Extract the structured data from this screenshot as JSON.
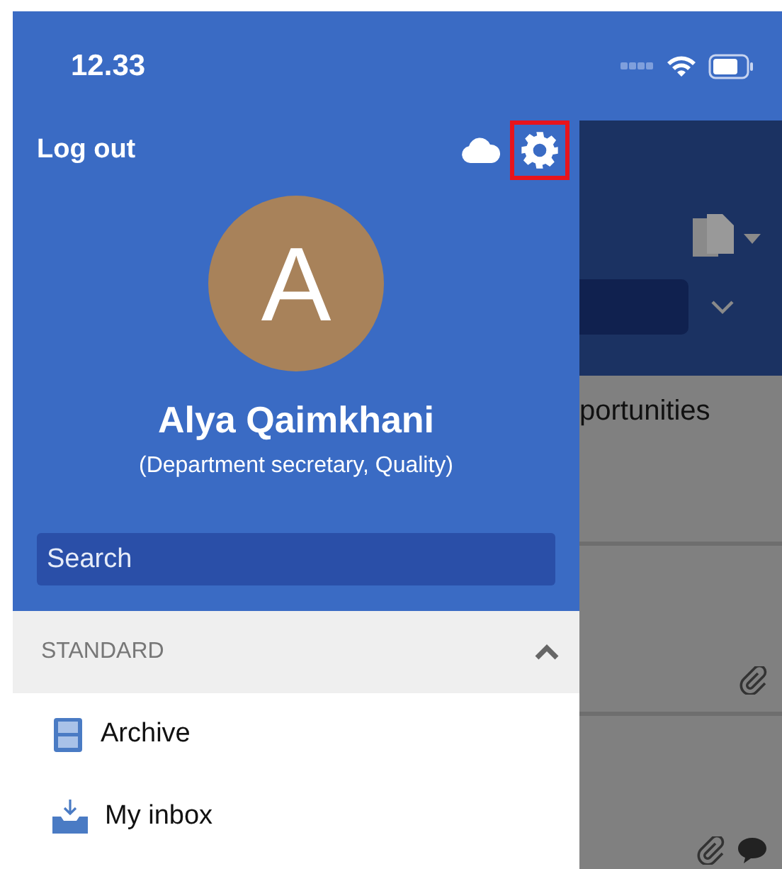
{
  "status_bar": {
    "time": "12.33"
  },
  "drawer": {
    "logout": "Log out",
    "settings": {
      "highlighted": true
    },
    "avatar_letter": "A",
    "name": "Alya Qaimkhani",
    "role": "(Department secretary, Quality)",
    "search": {
      "placeholder": "Search"
    },
    "section": {
      "title": "STANDARD",
      "expanded": true
    },
    "items": [
      {
        "label": "Archive",
        "kind": "archive"
      },
      {
        "label": "My inbox",
        "kind": "inbox"
      }
    ]
  },
  "background": {
    "rows": [
      {
        "text": "portunities",
        "attachment": false,
        "comment": false
      },
      {
        "attachment": true,
        "comment": false
      },
      {
        "attachment": true,
        "comment": true
      }
    ]
  }
}
